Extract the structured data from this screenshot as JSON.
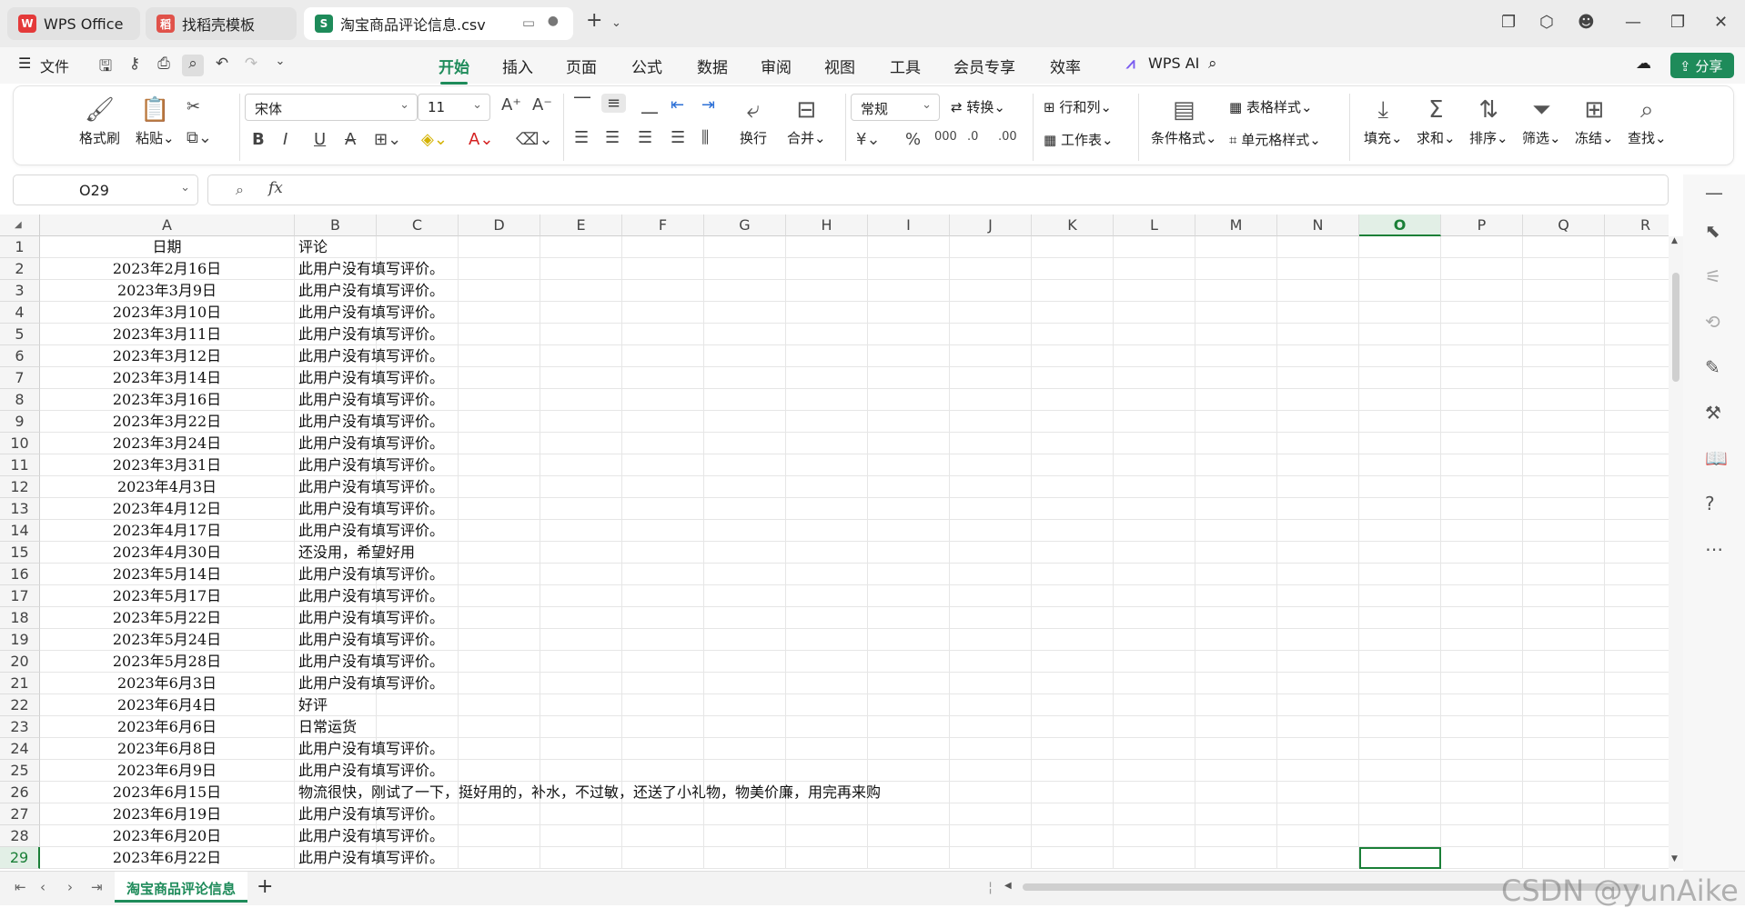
{
  "tabs": {
    "wps": "WPS Office",
    "daoke": "找稻壳模板",
    "file": "淘宝商品评论信息.csv"
  },
  "menu": {
    "file": "文件",
    "items": [
      "开始",
      "插入",
      "页面",
      "公式",
      "数据",
      "审阅",
      "视图",
      "工具",
      "会员专享",
      "效率"
    ],
    "active": "开始",
    "wps_ai": "WPS AI",
    "share": "分享"
  },
  "ribbon": {
    "format_painter": "格式刷",
    "paste": "粘贴",
    "font_name": "宋体",
    "font_size": "11",
    "wrap": "换行",
    "merge": "合并",
    "number_format": "常规",
    "convert": "转换",
    "rows_cols": "行和列",
    "worksheet": "工作表",
    "cond_format": "条件格式",
    "table_style": "表格样式",
    "cell_style": "单元格样式",
    "fill": "填充",
    "sum": "求和",
    "sort": "排序",
    "filter": "筛选",
    "freeze": "冻结",
    "find": "查找"
  },
  "formula": {
    "cell_ref": "O29",
    "fx": "fx",
    "content": ""
  },
  "columns": [
    "A",
    "B",
    "C",
    "D",
    "E",
    "F",
    "G",
    "H",
    "I",
    "J",
    "K",
    "L",
    "M",
    "N",
    "O",
    "P",
    "Q",
    "R"
  ],
  "selected_column": "O",
  "selected_row": "29",
  "rows": [
    {
      "n": "1",
      "a": "日期",
      "b": "评论"
    },
    {
      "n": "2",
      "a": "2023年2月16日",
      "b": "此用户没有填写评价。"
    },
    {
      "n": "3",
      "a": "2023年3月9日",
      "b": "此用户没有填写评价。"
    },
    {
      "n": "4",
      "a": "2023年3月10日",
      "b": "此用户没有填写评价。"
    },
    {
      "n": "5",
      "a": "2023年3月11日",
      "b": "此用户没有填写评价。"
    },
    {
      "n": "6",
      "a": "2023年3月12日",
      "b": "此用户没有填写评价。"
    },
    {
      "n": "7",
      "a": "2023年3月14日",
      "b": "此用户没有填写评价。"
    },
    {
      "n": "8",
      "a": "2023年3月16日",
      "b": "此用户没有填写评价。"
    },
    {
      "n": "9",
      "a": "2023年3月22日",
      "b": "此用户没有填写评价。"
    },
    {
      "n": "10",
      "a": "2023年3月24日",
      "b": "此用户没有填写评价。"
    },
    {
      "n": "11",
      "a": "2023年3月31日",
      "b": "此用户没有填写评价。"
    },
    {
      "n": "12",
      "a": "2023年4月3日",
      "b": "此用户没有填写评价。"
    },
    {
      "n": "13",
      "a": "2023年4月12日",
      "b": "此用户没有填写评价。"
    },
    {
      "n": "14",
      "a": "2023年4月17日",
      "b": "此用户没有填写评价。"
    },
    {
      "n": "15",
      "a": "2023年4月30日",
      "b": "还没用，希望好用"
    },
    {
      "n": "16",
      "a": "2023年5月14日",
      "b": "此用户没有填写评价。"
    },
    {
      "n": "17",
      "a": "2023年5月17日",
      "b": "此用户没有填写评价。"
    },
    {
      "n": "18",
      "a": "2023年5月22日",
      "b": "此用户没有填写评价。"
    },
    {
      "n": "19",
      "a": "2023年5月24日",
      "b": "此用户没有填写评价。"
    },
    {
      "n": "20",
      "a": "2023年5月28日",
      "b": "此用户没有填写评价。"
    },
    {
      "n": "21",
      "a": "2023年6月3日",
      "b": "此用户没有填写评价。"
    },
    {
      "n": "22",
      "a": "2023年6月4日",
      "b": "好评"
    },
    {
      "n": "23",
      "a": "2023年6月6日",
      "b": "日常运货"
    },
    {
      "n": "24",
      "a": "2023年6月8日",
      "b": "此用户没有填写评价。"
    },
    {
      "n": "25",
      "a": "2023年6月9日",
      "b": "此用户没有填写评价。"
    },
    {
      "n": "26",
      "a": "2023年6月15日",
      "b": "物流很快，刚试了一下，挺好用的，补水，不过敏，还送了小礼物，物美价廉，用完再来购"
    },
    {
      "n": "27",
      "a": "2023年6月19日",
      "b": "此用户没有填写评价。"
    },
    {
      "n": "28",
      "a": "2023年6月20日",
      "b": "此用户没有填写评价。"
    },
    {
      "n": "29",
      "a": "2023年6月22日",
      "b": "此用户没有填写评价。"
    }
  ],
  "sheet": {
    "name": "淘宝商品评论信息",
    "add": "+"
  },
  "watermark": "CSDN @yunAike",
  "colors": {
    "accent": "#1e8b5a",
    "selection": "#1a7f37"
  }
}
